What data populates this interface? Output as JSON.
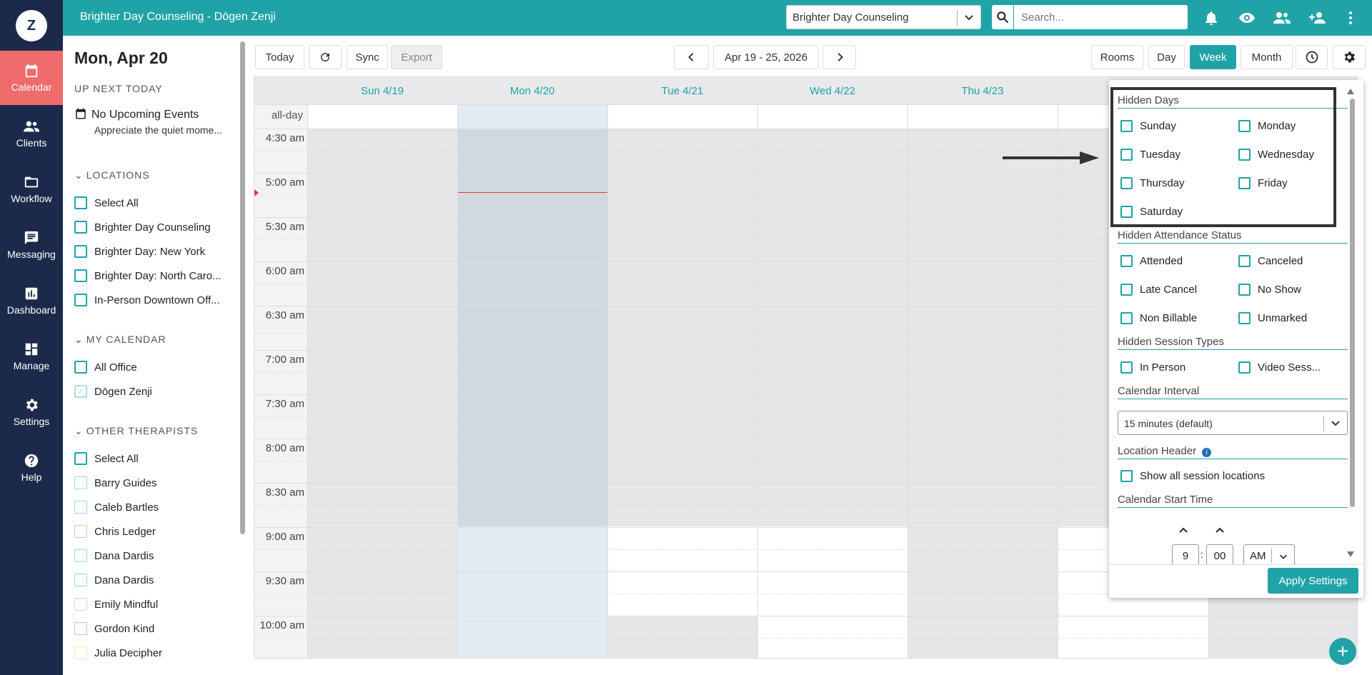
{
  "logo_letter": "Z",
  "nav": [
    {
      "label": "Calendar",
      "icon": "calendar-icon"
    },
    {
      "label": "Clients",
      "icon": "clients-icon"
    },
    {
      "label": "Workflow",
      "icon": "folder-icon"
    },
    {
      "label": "Messaging",
      "icon": "message-icon"
    },
    {
      "label": "Dashboard",
      "icon": "chart-icon"
    },
    {
      "label": "Manage",
      "icon": "dashboard-icon"
    },
    {
      "label": "Settings",
      "icon": "gear-icon"
    },
    {
      "label": "Help",
      "icon": "help-icon"
    }
  ],
  "header": {
    "title": "Brighter Day Counseling - Dōgen Zenji",
    "location_select": "Brighter Day Counseling",
    "search_placeholder": "Search..."
  },
  "sidebar": {
    "date": "Mon, Apr 20",
    "up_next": "UP NEXT TODAY",
    "event_title": "No Upcoming Events",
    "event_sub": "Appreciate the quiet mome...",
    "locations_header": "LOCATIONS",
    "locations": [
      "Select All",
      "Brighter Day Counseling",
      "Brighter Day: New York",
      "Brighter Day: North Caro...",
      "In-Person Downtown Off..."
    ],
    "mycal_header": "MY CALENDAR",
    "mycal": [
      "All Office",
      "Dōgen Zenji"
    ],
    "others_header": "OTHER THERAPISTS",
    "others": [
      "Select All",
      "Barry Guides",
      "Caleb Bartles",
      "Chris Ledger",
      "Dana Dardis",
      "Dana Dardis",
      "Emily Mindful",
      "Gordon Kind",
      "Julia Decipher"
    ]
  },
  "toolbar": {
    "today": "Today",
    "sync": "Sync",
    "export": "Export",
    "range": "Apr 19 - 25, 2026",
    "rooms": "Rooms",
    "day": "Day",
    "week": "Week",
    "month": "Month"
  },
  "calendar": {
    "days": [
      "Sun 4/19",
      "Mon 4/20",
      "Tue 4/21",
      "Wed 4/22",
      "Thu 4/23"
    ],
    "allday": "all-day",
    "times": [
      "4:30 am",
      "5:00 am",
      "5:30 am",
      "6:00 am",
      "6:30 am",
      "7:00 am",
      "7:30 am",
      "8:00 am",
      "8:30 am",
      "9:00 am",
      "9:30 am",
      "10:00 am"
    ]
  },
  "settings": {
    "hidden_days": "Hidden Days",
    "days": [
      "Sunday",
      "Monday",
      "Tuesday",
      "Wednesday",
      "Thursday",
      "Friday",
      "Saturday"
    ],
    "hidden_attendance": "Hidden Attendance Status",
    "attendance": [
      "Attended",
      "Canceled",
      "Late Cancel",
      "No Show",
      "Non Billable",
      "Unmarked"
    ],
    "hidden_session": "Hidden Session Types",
    "sessions": [
      "In Person",
      "Video Sess..."
    ],
    "interval_header": "Calendar Interval",
    "interval_value": "15 minutes (default)",
    "location_header": "Location Header",
    "show_locations": "Show all session locations",
    "start_time_header": "Calendar Start Time",
    "start_hour": "9",
    "start_min": "00",
    "start_ampm": "AM",
    "apply": "Apply Settings"
  }
}
